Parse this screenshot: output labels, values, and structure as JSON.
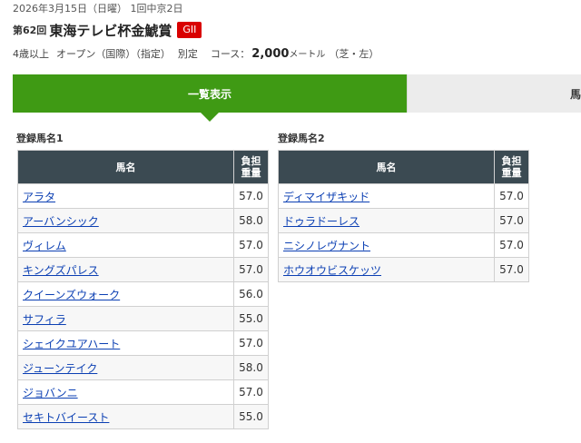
{
  "race": {
    "date": "2026年3月15日（日曜） 1回中京2日",
    "number": "第62回",
    "name": "東海テレビ杯金鯱賞",
    "grade": "GII",
    "conditions": [
      "4歳以上",
      "オープン（国際）（指定）",
      "別定"
    ],
    "course_label": "コース：",
    "distance": "2,000",
    "distance_unit": "メートル",
    "surface": "（芝・左）"
  },
  "tabs": [
    {
      "label": "一覧表示",
      "active": true
    },
    {
      "label": "馬",
      "active": false
    }
  ],
  "groups": [
    {
      "title": "登録馬名1",
      "col_name": "馬名",
      "col_weight": "負担重量",
      "rows": [
        {
          "name": "アラタ",
          "weight": "57.0"
        },
        {
          "name": "アーバンシック",
          "weight": "58.0"
        },
        {
          "name": "ヴィレム",
          "weight": "57.0"
        },
        {
          "name": "キングズパレス",
          "weight": "57.0"
        },
        {
          "name": "クイーンズウォーク",
          "weight": "56.0"
        },
        {
          "name": "サフィラ",
          "weight": "55.0"
        },
        {
          "name": "シェイクユアハート",
          "weight": "57.0"
        },
        {
          "name": "ジューンテイク",
          "weight": "58.0"
        },
        {
          "name": "ジョバンニ",
          "weight": "57.0"
        },
        {
          "name": "セキトバイースト",
          "weight": "55.0"
        }
      ]
    },
    {
      "title": "登録馬名2",
      "col_name": "馬名",
      "col_weight": "負担重量",
      "rows": [
        {
          "name": "ディマイザキッド",
          "weight": "57.0"
        },
        {
          "name": "ドゥラドーレス",
          "weight": "57.0"
        },
        {
          "name": "ニシノレヴナント",
          "weight": "57.0"
        },
        {
          "name": "ホウオウビスケッツ",
          "weight": "57.0"
        }
      ]
    }
  ],
  "colors": {
    "tab_active": "#3f9a14",
    "table_header": "#3b4a52",
    "grade_badge": "#d90000",
    "link": "#0b3fb3"
  }
}
